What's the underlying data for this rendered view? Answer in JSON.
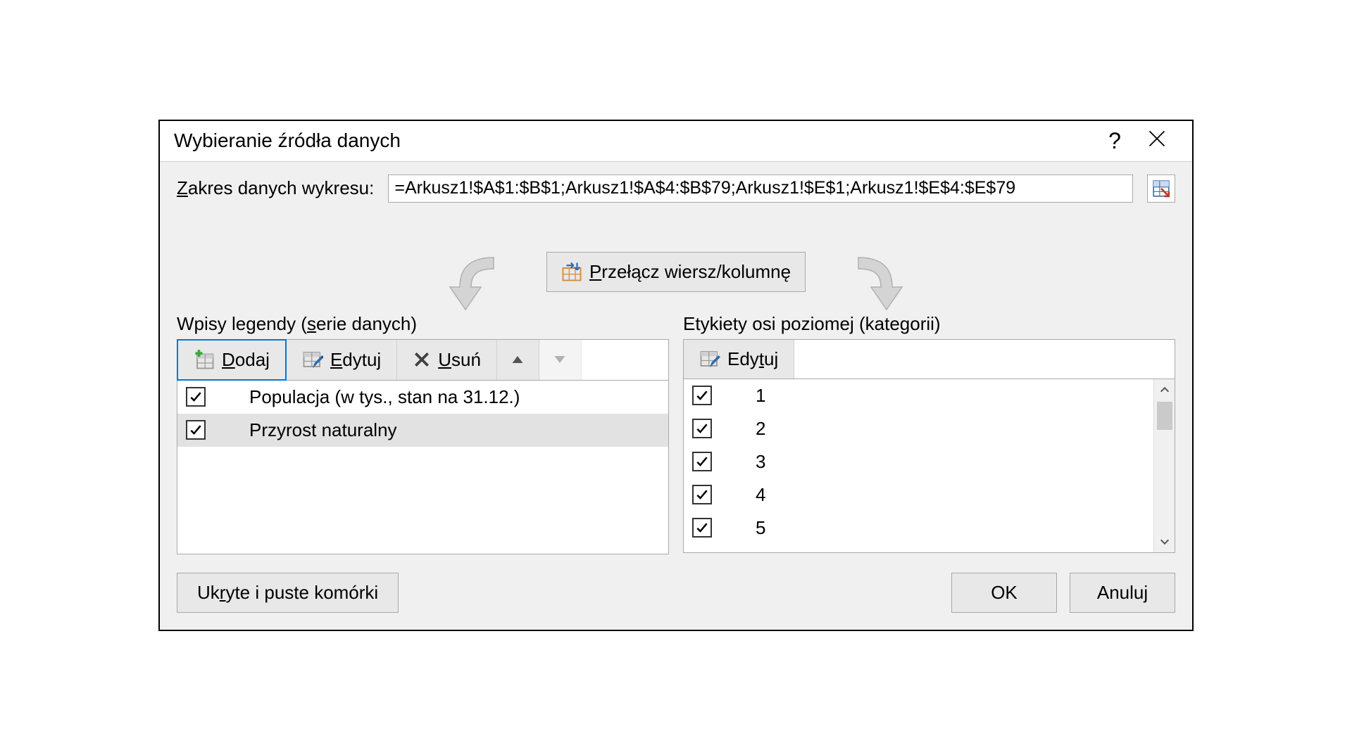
{
  "dialog": {
    "title": "Wybieranie źródła danych",
    "help": "?",
    "range_label_pre": "Z",
    "range_label_rest": "akres danych wykresu:",
    "range_value": "=Arkusz1!$A$1:$B$1;Arkusz1!$A$4:$B$79;Arkusz1!$E$1;Arkusz1!$E$4:$E$79",
    "switch_pre": "P",
    "switch_rest": "rzełącz wiersz/kolumnę",
    "legend_label_pre": "Wpisy legendy (",
    "legend_label_ul": "s",
    "legend_label_post": "erie danych)",
    "axis_label_pre": "Etykiety osi poziome",
    "axis_label_ul": "j",
    "axis_label_post": " (kategorii)",
    "add_ul": "D",
    "add_rest": "odaj",
    "edit_ul": "E",
    "edit_rest": "dytuj",
    "remove_ul": "U",
    "remove_rest": "suń",
    "edit2_pre": "Edy",
    "edit2_ul": "t",
    "edit2_post": "uj",
    "series": [
      {
        "label": "Populacja (w tys., stan na 31.12.)",
        "checked": true,
        "selected": false
      },
      {
        "label": "Przyrost naturalny",
        "checked": true,
        "selected": true
      }
    ],
    "categories": [
      {
        "label": "1",
        "checked": true
      },
      {
        "label": "2",
        "checked": true
      },
      {
        "label": "3",
        "checked": true
      },
      {
        "label": "4",
        "checked": true
      },
      {
        "label": "5",
        "checked": true
      }
    ],
    "hidden_pre": "Uk",
    "hidden_ul": "r",
    "hidden_post": "yte i puste komórki",
    "ok": "OK",
    "cancel": "Anuluj"
  }
}
